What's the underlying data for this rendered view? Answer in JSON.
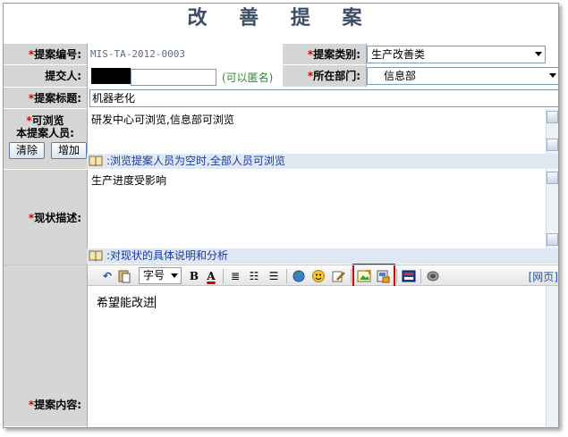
{
  "title": "改 善 提 案",
  "fields": {
    "proposal_no_label": "提案编号:",
    "proposal_no_value": "MIS-TA-2012-0003",
    "proposal_type_label": "提案类别:",
    "proposal_type_value": "生产改善类",
    "submitter_label": "提交人:",
    "anonymous_label": "(可以匿名)",
    "department_label": "所在部门:",
    "department_value": "信息部",
    "subject_label": "提案标题:",
    "subject_value": "机器老化",
    "viewers_label_1": "可浏览",
    "viewers_label_2": "本提案人员:",
    "viewers_value": "研发中心可浏览,信息部可浏览",
    "viewers_hint": ":浏览提案人员为空时,全部人员可浏览",
    "clear_button": "清除",
    "add_button": "增加",
    "status_label": "现状描述:",
    "status_value": "生产进度受影响",
    "status_hint": ":对现状的具体说明和分析",
    "content_label": "提案内容:",
    "content_value": "希望能改进",
    "font_size_select": "字号",
    "webpage_link": "[网页]"
  },
  "colors": {
    "required_star": "#d40000",
    "label_bg": "#d6d6d6",
    "hint_text": "#1a3aa0",
    "anonymous_text": "#2e8b2e",
    "highlight_box": "#d00000"
  }
}
